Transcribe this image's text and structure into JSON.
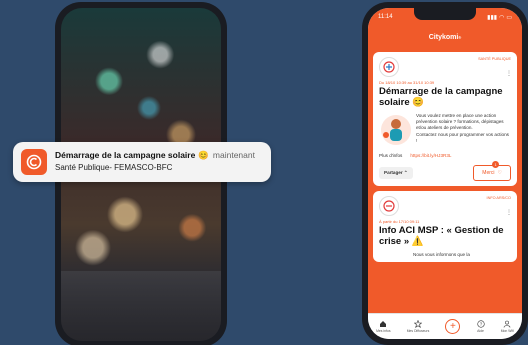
{
  "notification": {
    "title": "Démarrage de la campagne solaire",
    "emoji": "😊",
    "time": "maintenant",
    "subtitle": "Santé Publique- FEMASCO-BFC"
  },
  "app": {
    "status_time": "11:14",
    "name": "Citykomi",
    "name_mark": "®"
  },
  "card1": {
    "category": "SANTÉ PUBLIQUE",
    "date": "Du 18/10 10:39 au 31/10 10:39",
    "title": "Démarrage de la campagne solaire",
    "emoji": "😊",
    "description": "Vous voulez mettre en place une action prévention solaire ? formations, dépistages et/ou ateliers de prévention.",
    "description2": "Contactez nous pour programmer vos actions !",
    "info_label": "Plus d'infos",
    "info_link": "https://bit.ly/3L...",
    "info_link_display": "https://bit.ly/HJ3R3L",
    "share_label": "Partager",
    "thanks_label": "Merci",
    "thanks_count": "1"
  },
  "card2": {
    "category": "INFO ARS/CO",
    "date": "À partir du 17/10 09:11",
    "title": "Info ACI MSP : « Gestion de crise »",
    "emoji": "⚠️",
    "text": "Nous vous informons que la"
  },
  "nav": {
    "items": [
      {
        "label": "Mes infos",
        "icon": "home-icon"
      },
      {
        "label": "Mes Diffuseurs",
        "icon": "star-icon"
      },
      {
        "label": "",
        "icon": "plus-icon"
      },
      {
        "label": "Aide",
        "icon": "help-icon"
      },
      {
        "label": "Mon Wifi",
        "icon": "user-icon"
      }
    ]
  },
  "colors": {
    "accent": "#f05a2a",
    "background": "#2f4a6b"
  }
}
